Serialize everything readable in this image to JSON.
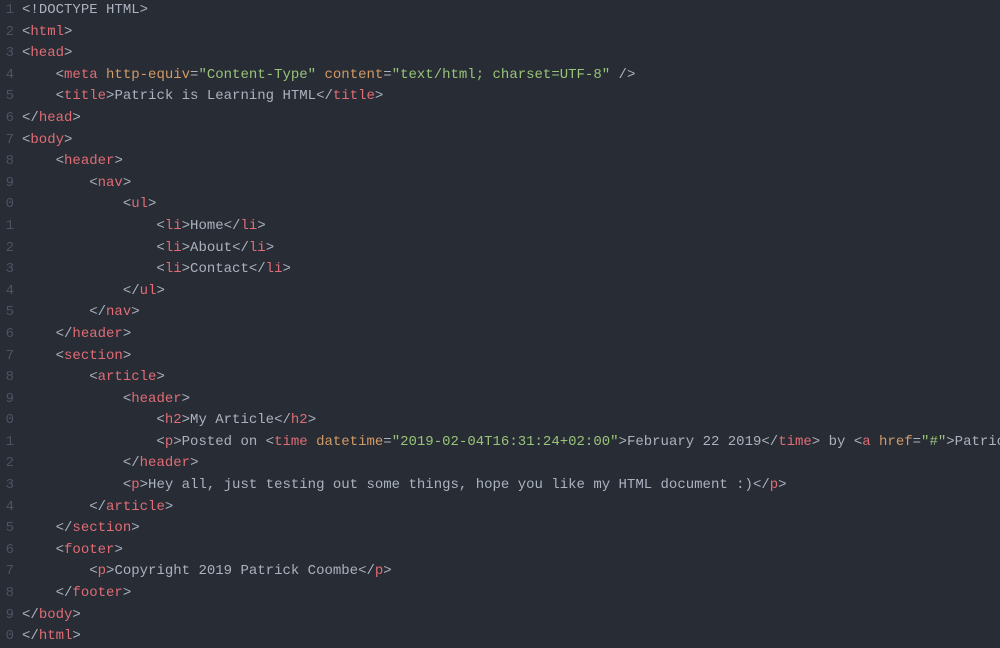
{
  "gutter": [
    "1",
    "2",
    "3",
    "4",
    "5",
    "6",
    "7",
    "8",
    "9",
    "0",
    "1",
    "2",
    "3",
    "4",
    "5",
    "6",
    "7",
    "8",
    "9",
    "0",
    "1",
    "2",
    "3",
    "4",
    "5",
    "6",
    "7",
    "8",
    "9",
    "0"
  ],
  "lines": [
    {
      "indent": 0,
      "tokens": [
        {
          "t": "<!",
          "c": "gray"
        },
        {
          "t": "DOCTYPE HTML",
          "c": "doctype"
        },
        {
          "t": ">",
          "c": "gray"
        }
      ]
    },
    {
      "indent": 0,
      "tokens": [
        {
          "t": "<",
          "c": "gray"
        },
        {
          "t": "html",
          "c": "tag"
        },
        {
          "t": ">",
          "c": "gray"
        }
      ]
    },
    {
      "indent": 0,
      "tokens": [
        {
          "t": "<",
          "c": "gray"
        },
        {
          "t": "head",
          "c": "tag"
        },
        {
          "t": ">",
          "c": "gray"
        }
      ]
    },
    {
      "indent": 1,
      "tokens": [
        {
          "t": "<",
          "c": "gray"
        },
        {
          "t": "meta",
          "c": "tag"
        },
        {
          "t": " ",
          "c": "gray"
        },
        {
          "t": "http-equiv",
          "c": "attr"
        },
        {
          "t": "=",
          "c": "gray"
        },
        {
          "t": "\"Content-Type\"",
          "c": "val"
        },
        {
          "t": " ",
          "c": "gray"
        },
        {
          "t": "content",
          "c": "attr"
        },
        {
          "t": "=",
          "c": "gray"
        },
        {
          "t": "\"text/html; charset=UTF-8\"",
          "c": "val"
        },
        {
          "t": " />",
          "c": "gray"
        }
      ]
    },
    {
      "indent": 1,
      "tokens": [
        {
          "t": "<",
          "c": "gray"
        },
        {
          "t": "title",
          "c": "tag"
        },
        {
          "t": ">",
          "c": "gray"
        },
        {
          "t": "Patrick is Learning HTML",
          "c": "text"
        },
        {
          "t": "</",
          "c": "gray"
        },
        {
          "t": "title",
          "c": "tag"
        },
        {
          "t": ">",
          "c": "gray"
        }
      ]
    },
    {
      "indent": 0,
      "tokens": [
        {
          "t": "</",
          "c": "gray"
        },
        {
          "t": "head",
          "c": "tag"
        },
        {
          "t": ">",
          "c": "gray"
        }
      ]
    },
    {
      "indent": 0,
      "tokens": [
        {
          "t": "<",
          "c": "gray"
        },
        {
          "t": "body",
          "c": "tag"
        },
        {
          "t": ">",
          "c": "gray"
        }
      ]
    },
    {
      "indent": 1,
      "tokens": [
        {
          "t": "<",
          "c": "gray"
        },
        {
          "t": "header",
          "c": "tag"
        },
        {
          "t": ">",
          "c": "gray"
        }
      ]
    },
    {
      "indent": 2,
      "tokens": [
        {
          "t": "<",
          "c": "gray"
        },
        {
          "t": "nav",
          "c": "tag"
        },
        {
          "t": ">",
          "c": "gray"
        }
      ]
    },
    {
      "indent": 3,
      "tokens": [
        {
          "t": "<",
          "c": "gray"
        },
        {
          "t": "ul",
          "c": "tag"
        },
        {
          "t": ">",
          "c": "gray"
        }
      ]
    },
    {
      "indent": 4,
      "tokens": [
        {
          "t": "<",
          "c": "gray"
        },
        {
          "t": "li",
          "c": "tag"
        },
        {
          "t": ">",
          "c": "gray"
        },
        {
          "t": "Home",
          "c": "text"
        },
        {
          "t": "</",
          "c": "gray"
        },
        {
          "t": "li",
          "c": "tag"
        },
        {
          "t": ">",
          "c": "gray"
        }
      ]
    },
    {
      "indent": 4,
      "tokens": [
        {
          "t": "<",
          "c": "gray"
        },
        {
          "t": "li",
          "c": "tag"
        },
        {
          "t": ">",
          "c": "gray"
        },
        {
          "t": "About",
          "c": "text"
        },
        {
          "t": "</",
          "c": "gray"
        },
        {
          "t": "li",
          "c": "tag"
        },
        {
          "t": ">",
          "c": "gray"
        }
      ]
    },
    {
      "indent": 4,
      "tokens": [
        {
          "t": "<",
          "c": "gray"
        },
        {
          "t": "li",
          "c": "tag"
        },
        {
          "t": ">",
          "c": "gray"
        },
        {
          "t": "Contact",
          "c": "text"
        },
        {
          "t": "</",
          "c": "gray"
        },
        {
          "t": "li",
          "c": "tag"
        },
        {
          "t": ">",
          "c": "gray"
        }
      ]
    },
    {
      "indent": 3,
      "tokens": [
        {
          "t": "</",
          "c": "gray"
        },
        {
          "t": "ul",
          "c": "tag"
        },
        {
          "t": ">",
          "c": "gray"
        }
      ]
    },
    {
      "indent": 2,
      "tokens": [
        {
          "t": "</",
          "c": "gray"
        },
        {
          "t": "nav",
          "c": "tag"
        },
        {
          "t": ">",
          "c": "gray"
        }
      ]
    },
    {
      "indent": 1,
      "tokens": [
        {
          "t": "</",
          "c": "gray"
        },
        {
          "t": "header",
          "c": "tag"
        },
        {
          "t": ">",
          "c": "gray"
        }
      ]
    },
    {
      "indent": 1,
      "tokens": [
        {
          "t": "<",
          "c": "gray"
        },
        {
          "t": "section",
          "c": "tag"
        },
        {
          "t": ">",
          "c": "gray"
        }
      ]
    },
    {
      "indent": 2,
      "tokens": [
        {
          "t": "<",
          "c": "gray"
        },
        {
          "t": "article",
          "c": "tag"
        },
        {
          "t": ">",
          "c": "gray"
        }
      ]
    },
    {
      "indent": 3,
      "tokens": [
        {
          "t": "<",
          "c": "gray"
        },
        {
          "t": "header",
          "c": "tag"
        },
        {
          "t": ">",
          "c": "gray"
        }
      ]
    },
    {
      "indent": 4,
      "tokens": [
        {
          "t": "<",
          "c": "gray"
        },
        {
          "t": "h2",
          "c": "tag"
        },
        {
          "t": ">",
          "c": "gray"
        },
        {
          "t": "My Article",
          "c": "text"
        },
        {
          "t": "</",
          "c": "gray"
        },
        {
          "t": "h2",
          "c": "tag"
        },
        {
          "t": ">",
          "c": "gray"
        }
      ]
    },
    {
      "indent": 4,
      "tokens": [
        {
          "t": "<",
          "c": "gray"
        },
        {
          "t": "p",
          "c": "tag"
        },
        {
          "t": ">",
          "c": "gray"
        },
        {
          "t": "Posted on ",
          "c": "text"
        },
        {
          "t": "<",
          "c": "gray"
        },
        {
          "t": "time",
          "c": "tag"
        },
        {
          "t": " ",
          "c": "gray"
        },
        {
          "t": "datetime",
          "c": "attr"
        },
        {
          "t": "=",
          "c": "gray"
        },
        {
          "t": "\"2019-02-04T16:31:24+02:00\"",
          "c": "val"
        },
        {
          "t": ">",
          "c": "gray"
        },
        {
          "t": "February 22 2019",
          "c": "text"
        },
        {
          "t": "</",
          "c": "gray"
        },
        {
          "t": "time",
          "c": "tag"
        },
        {
          "t": ">",
          "c": "gray"
        },
        {
          "t": " by ",
          "c": "text"
        },
        {
          "t": "<",
          "c": "gray"
        },
        {
          "t": "a",
          "c": "tag"
        },
        {
          "t": " ",
          "c": "gray"
        },
        {
          "t": "href",
          "c": "attr"
        },
        {
          "t": "=",
          "c": "gray"
        },
        {
          "t": "\"#\"",
          "c": "val"
        },
        {
          "t": ">",
          "c": "gray"
        },
        {
          "t": "Patric",
          "c": "text"
        }
      ]
    },
    {
      "indent": 3,
      "tokens": [
        {
          "t": "</",
          "c": "gray"
        },
        {
          "t": "header",
          "c": "tag"
        },
        {
          "t": ">",
          "c": "gray"
        }
      ]
    },
    {
      "indent": 3,
      "tokens": [
        {
          "t": "<",
          "c": "gray"
        },
        {
          "t": "p",
          "c": "tag"
        },
        {
          "t": ">",
          "c": "gray"
        },
        {
          "t": "Hey all, just testing out some things, hope you like my HTML document :)",
          "c": "text"
        },
        {
          "t": "</",
          "c": "gray"
        },
        {
          "t": "p",
          "c": "tag"
        },
        {
          "t": ">",
          "c": "gray"
        }
      ]
    },
    {
      "indent": 2,
      "tokens": [
        {
          "t": "</",
          "c": "gray"
        },
        {
          "t": "article",
          "c": "tag"
        },
        {
          "t": ">",
          "c": "gray"
        }
      ]
    },
    {
      "indent": 1,
      "tokens": [
        {
          "t": "</",
          "c": "gray"
        },
        {
          "t": "section",
          "c": "tag"
        },
        {
          "t": ">",
          "c": "gray"
        }
      ]
    },
    {
      "indent": 1,
      "tokens": [
        {
          "t": "<",
          "c": "gray"
        },
        {
          "t": "footer",
          "c": "tag"
        },
        {
          "t": ">",
          "c": "gray"
        }
      ]
    },
    {
      "indent": 2,
      "tokens": [
        {
          "t": "<",
          "c": "gray"
        },
        {
          "t": "p",
          "c": "tag"
        },
        {
          "t": ">",
          "c": "gray"
        },
        {
          "t": "Copyright 2019 Patrick Coombe",
          "c": "text"
        },
        {
          "t": "</",
          "c": "gray"
        },
        {
          "t": "p",
          "c": "tag"
        },
        {
          "t": ">",
          "c": "gray"
        }
      ]
    },
    {
      "indent": 1,
      "tokens": [
        {
          "t": "</",
          "c": "gray"
        },
        {
          "t": "footer",
          "c": "tag"
        },
        {
          "t": ">",
          "c": "gray"
        }
      ]
    },
    {
      "indent": 0,
      "tokens": [
        {
          "t": "</",
          "c": "gray"
        },
        {
          "t": "body",
          "c": "tag"
        },
        {
          "t": ">",
          "c": "gray"
        }
      ]
    },
    {
      "indent": 0,
      "tokens": [
        {
          "t": "</",
          "c": "gray"
        },
        {
          "t": "html",
          "c": "tag"
        },
        {
          "t": ">",
          "c": "gray"
        }
      ]
    }
  ],
  "indentUnit": "    "
}
